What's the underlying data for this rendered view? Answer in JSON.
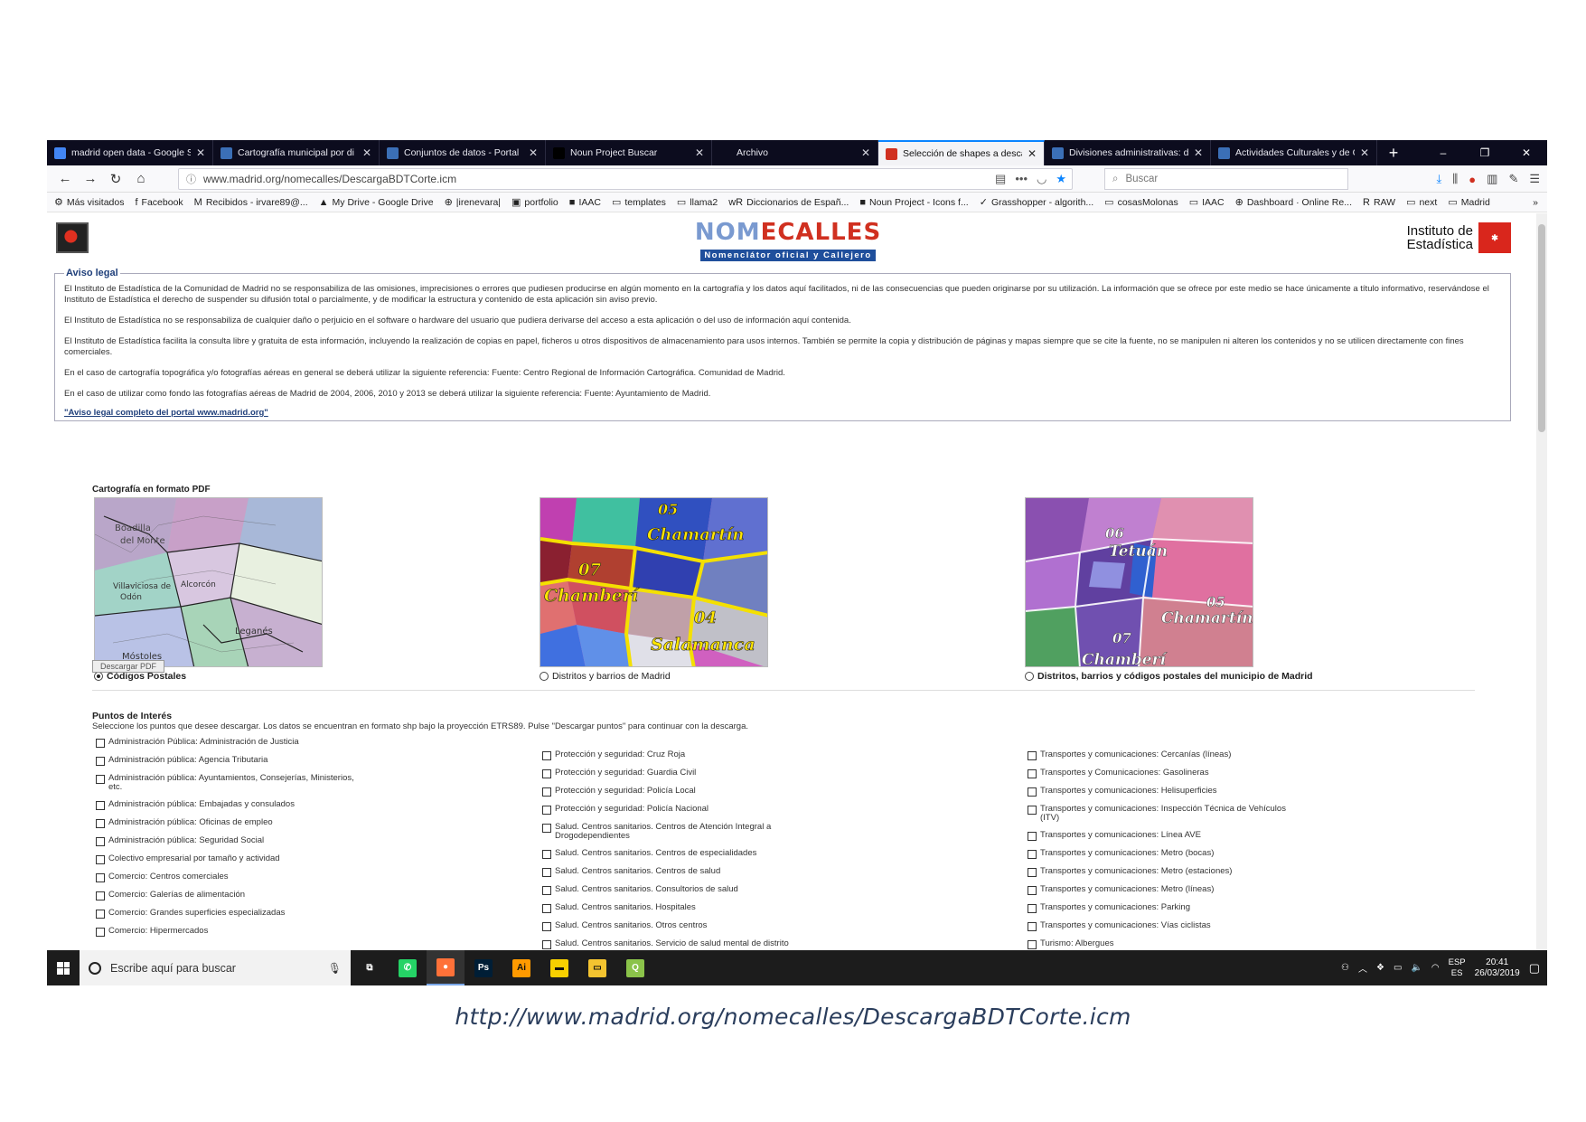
{
  "browser": {
    "tabs": [
      {
        "title": "madrid open data - Google S",
        "favicon_color": "#4285f4",
        "active": false
      },
      {
        "title": "Cartografía municipal por di",
        "favicon_color": "#3b6fb6",
        "active": false
      },
      {
        "title": "Conjuntos de datos - Portal",
        "favicon_color": "#3b6fb6",
        "active": false
      },
      {
        "title": "Noun Project Buscar",
        "favicon_color": "#000000",
        "active": false
      },
      {
        "title": "Archivo",
        "favicon_color": "#0c0c1e",
        "active": false
      },
      {
        "title": "Selección de shapes a descar",
        "favicon_color": "#d03020",
        "active": true
      },
      {
        "title": "Divisiones administrativas: di",
        "favicon_color": "#3b6fb6",
        "active": false
      },
      {
        "title": "Actividades Culturales y de O",
        "favicon_color": "#3b6fb6",
        "active": false
      }
    ],
    "new_tab": "+",
    "window_controls": [
      "–",
      "❐",
      "✕"
    ],
    "url": "www.madrid.org/nomecalles/DescargaBDTCorte.icm",
    "search_placeholder": "Buscar",
    "bookmarks": [
      {
        "icon": "gear-icon",
        "glyph": "⚙",
        "label": "Más visitados"
      },
      {
        "icon": "facebook-icon",
        "glyph": "f",
        "label": "Facebook"
      },
      {
        "icon": "gmail-icon",
        "glyph": "M",
        "label": "Recibidos - irvare89@..."
      },
      {
        "icon": "drive-icon",
        "glyph": "▲",
        "label": "My Drive - Google Drive"
      },
      {
        "icon": "globe-icon",
        "glyph": "⊕",
        "label": "|irenevara|"
      },
      {
        "icon": "portfolio-icon",
        "glyph": "▣",
        "label": "portfolio"
      },
      {
        "icon": "iaac-icon",
        "glyph": "■",
        "label": "IAAC"
      },
      {
        "icon": "folder-icon",
        "glyph": "▭",
        "label": "templates"
      },
      {
        "icon": "folder-icon",
        "glyph": "▭",
        "label": "llama2"
      },
      {
        "icon": "wr-icon",
        "glyph": "wR",
        "label": "Diccionarios de Españ..."
      },
      {
        "icon": "noun-icon",
        "glyph": "■",
        "label": "Noun Project - Icons f..."
      },
      {
        "icon": "grasshopper-icon",
        "glyph": "✓",
        "label": "Grasshopper - algorith..."
      },
      {
        "icon": "folder-icon",
        "glyph": "▭",
        "label": "cosasMolonas"
      },
      {
        "icon": "folder-icon",
        "glyph": "▭",
        "label": "IAAC"
      },
      {
        "icon": "globe-icon",
        "glyph": "⊕",
        "label": "Dashboard · Online Re..."
      },
      {
        "icon": "raw-icon",
        "glyph": "R",
        "label": "RAW"
      },
      {
        "icon": "folder-icon",
        "glyph": "▭",
        "label": "next"
      },
      {
        "icon": "folder-icon",
        "glyph": "▭",
        "label": "Madrid"
      }
    ]
  },
  "header": {
    "logo_top": "NOMECALLES",
    "logo_sub": "Nomenclátor oficial y Callejero",
    "institute": "Instituto de Estadística",
    "institute_line1": "Instituto de",
    "institute_line2": "Estadística"
  },
  "aviso": {
    "legend": "Aviso legal",
    "paragraphs": [
      "El Instituto de Estadística de la Comunidad de Madrid no se responsabiliza de las omisiones, imprecisiones o errores que pudiesen producirse en algún momento en la cartografía y los datos aquí facilitados, ni de las consecuencias que pueden originarse por su utilización. La información que se ofrece por este medio se hace únicamente a título informativo, reservándose el Instituto de Estadística el derecho de suspender su difusión total o parcialmente, y de modificar la estructura y contenido de esta aplicación sin aviso previo.",
      "El Instituto de Estadística no se responsabiliza de cualquier daño o perjuicio en el software o hardware del usuario que pudiera derivarse del acceso a esta aplicación o del uso de información aquí contenida.",
      "El Instituto de Estadística facilita la consulta libre y gratuita de esta información, incluyendo la realización de copias en papel, ficheros u otros dispositivos de almacenamiento para usos internos. También se permite la copia y distribución de páginas y mapas siempre que se cite la fuente, no se manipulen ni alteren los contenidos y no se utilicen directamente con fines comerciales.",
      "En el caso de cartografía topográfica y/o fotografías aéreas en general se deberá utilizar la siguiente referencia: Fuente: Centro Regional de Información Cartográfica. Comunidad de Madrid.",
      "En el caso de utilizar como fondo las fotografías aéreas de Madrid de 2004, 2006, 2010 y 2013 se deberá utilizar la siguiente referencia: Fuente: Ayuntamiento de Madrid."
    ],
    "link": "\"Aviso legal completo del portal www.madrid.org\""
  },
  "pdf": {
    "title": "Cartografía en formato PDF",
    "options": [
      {
        "label": "Códigos Postales",
        "selected": true,
        "map_words": [
          "Boadilla del Monte",
          "Villaviciosa de Odón",
          "Leganés",
          "Alcorcón",
          "Móstoles"
        ]
      },
      {
        "label": "Distritos y barrios de Madrid",
        "selected": false,
        "map_words": [
          "05",
          "Chamartín",
          "07",
          "Chamberí",
          "04",
          "Salamanca"
        ]
      },
      {
        "label": "Distritos, barrios y códigos postales del municipio de Madrid",
        "selected": false,
        "map_words": [
          "06",
          "Tetuán",
          "05",
          "Chamartín",
          "07",
          "Chamberí"
        ]
      }
    ],
    "download_button": "Descargar PDF"
  },
  "poi": {
    "title": "Puntos de Interés",
    "description": "Seleccione los puntos que desee descargar. Los datos se encuentran en formato shp bajo la proyección ETRS89. Pulse \"Descargar puntos\" para continuar con la descarga.",
    "col1": [
      "Administración Pública: Administración de Justicia",
      "Administración pública: Agencia Tributaria",
      "Administración pública: Ayuntamientos, Consejerías, Ministerios, etc.",
      "Administración pública: Embajadas y consulados",
      "Administración pública: Oficinas de empleo",
      "Administración pública: Seguridad Social",
      "Colectivo empresarial por tamaño y actividad",
      "Comercio: Centros comerciales",
      "Comercio: Galerías de alimentación",
      "Comercio: Grandes superficies especializadas",
      "Comercio: Hipermercados"
    ],
    "col2": [
      "Protección y seguridad: Cruz Roja",
      "Protección y seguridad: Guardia Civil",
      "Protección y seguridad: Policía Local",
      "Protección y seguridad: Policía Nacional",
      "Salud. Centros sanitarios. Centros de Atención Integral a Drogodependientes",
      "Salud. Centros sanitarios. Centros de especialidades",
      "Salud. Centros sanitarios. Centros de salud",
      "Salud. Centros sanitarios. Consultorios de salud",
      "Salud. Centros sanitarios. Hospitales",
      "Salud. Centros sanitarios. Otros centros",
      "Salud. Centros sanitarios. Servicio de salud mental de distrito"
    ],
    "col3": [
      "Transportes y comunicaciones: Cercanías (líneas)",
      "Transportes y Comunicaciones: Gasolineras",
      "Transportes y comunicaciones: Helisuperficies",
      "Transportes y comunicaciones: Inspección Técnica de Vehículos (ITV)",
      "Transportes y comunicaciones: Línea AVE",
      "Transportes y comunicaciones: Metro (bocas)",
      "Transportes y comunicaciones: Metro (estaciones)",
      "Transportes y comunicaciones: Metro (líneas)",
      "Transportes y comunicaciones: Parking",
      "Transportes y comunicaciones: Vías ciclistas",
      "Turismo: Albergues"
    ]
  },
  "taskbar": {
    "search_placeholder": "Escribe aquí para buscar",
    "apps": [
      {
        "name": "task-view",
        "glyph": "⧉",
        "color": "#1c1c1c"
      },
      {
        "name": "whatsapp",
        "glyph": "✆",
        "color": "#25d366"
      },
      {
        "name": "firefox",
        "glyph": "●",
        "color": "#ff7139"
      },
      {
        "name": "photoshop",
        "glyph": "Ps",
        "color": "#001e36"
      },
      {
        "name": "illustrator",
        "glyph": "Ai",
        "color": "#ff9a00"
      },
      {
        "name": "sticky-notes",
        "glyph": "▬",
        "color": "#f7d000"
      },
      {
        "name": "file-explorer",
        "glyph": "▭",
        "color": "#f4c430"
      },
      {
        "name": "qgis",
        "glyph": "Q",
        "color": "#8bc34a"
      }
    ],
    "lang_top": "ESP",
    "lang_bottom": "ES",
    "time": "20:41",
    "date": "26/03/2019"
  },
  "caption": "http://www.madrid.org/nomecalles/DescargaBDTCorte.icm"
}
